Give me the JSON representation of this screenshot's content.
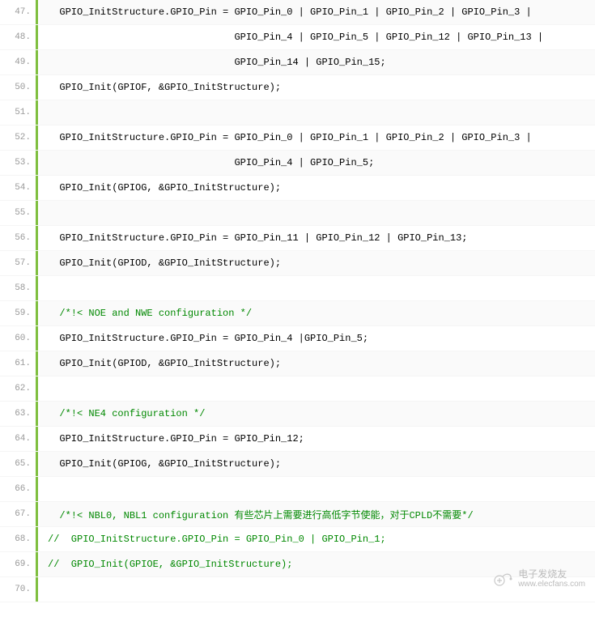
{
  "code": {
    "lines": [
      {
        "num": "47.",
        "text": "  GPIO_InitStructure.GPIO_Pin = GPIO_Pin_0 | GPIO_Pin_1 | GPIO_Pin_2 | GPIO_Pin_3 |",
        "type": "plain"
      },
      {
        "num": "48.",
        "text": "                                GPIO_Pin_4 | GPIO_Pin_5 | GPIO_Pin_12 | GPIO_Pin_13 |",
        "type": "plain"
      },
      {
        "num": "49.",
        "text": "                                GPIO_Pin_14 | GPIO_Pin_15;",
        "type": "plain"
      },
      {
        "num": "50.",
        "text": "  GPIO_Init(GPIOF, &GPIO_InitStructure);",
        "type": "plain"
      },
      {
        "num": "51.",
        "text": "",
        "type": "plain"
      },
      {
        "num": "52.",
        "text": "  GPIO_InitStructure.GPIO_Pin = GPIO_Pin_0 | GPIO_Pin_1 | GPIO_Pin_2 | GPIO_Pin_3 |",
        "type": "plain"
      },
      {
        "num": "53.",
        "text": "                                GPIO_Pin_4 | GPIO_Pin_5;",
        "type": "plain"
      },
      {
        "num": "54.",
        "text": "  GPIO_Init(GPIOG, &GPIO_InitStructure);",
        "type": "plain"
      },
      {
        "num": "55.",
        "text": "",
        "type": "plain"
      },
      {
        "num": "56.",
        "text": "  GPIO_InitStructure.GPIO_Pin = GPIO_Pin_11 | GPIO_Pin_12 | GPIO_Pin_13;",
        "type": "plain"
      },
      {
        "num": "57.",
        "text": "  GPIO_Init(GPIOD, &GPIO_InitStructure);",
        "type": "plain"
      },
      {
        "num": "58.",
        "text": "",
        "type": "plain"
      },
      {
        "num": "59.",
        "text": "  /*!< NOE and NWE configuration */",
        "type": "comment"
      },
      {
        "num": "60.",
        "text": "  GPIO_InitStructure.GPIO_Pin = GPIO_Pin_4 |GPIO_Pin_5;",
        "type": "plain"
      },
      {
        "num": "61.",
        "text": "  GPIO_Init(GPIOD, &GPIO_InitStructure);",
        "type": "plain"
      },
      {
        "num": "62.",
        "text": "",
        "type": "plain"
      },
      {
        "num": "63.",
        "text": "  /*!< NE4 configuration */",
        "type": "comment"
      },
      {
        "num": "64.",
        "text": "  GPIO_InitStructure.GPIO_Pin = GPIO_Pin_12;",
        "type": "plain"
      },
      {
        "num": "65.",
        "text": "  GPIO_Init(GPIOG, &GPIO_InitStructure);",
        "type": "plain"
      },
      {
        "num": "66.",
        "text": "",
        "type": "plain"
      },
      {
        "num": "67.",
        "text": "  /*!< NBL0, NBL1 configuration 有些芯片上需要进行高低字节使能，对于CPLD不需要*/",
        "type": "comment"
      },
      {
        "num": "68.",
        "text": "//  GPIO_InitStructure.GPIO_Pin = GPIO_Pin_0 | GPIO_Pin_1;",
        "type": "comment"
      },
      {
        "num": "69.",
        "text": "//  GPIO_Init(GPIOE, &GPIO_InitStructure);",
        "type": "comment"
      },
      {
        "num": "70.",
        "text": "",
        "type": "plain"
      }
    ]
  },
  "watermark": {
    "cn": "电子发烧友",
    "url": "www.elecfans.com"
  }
}
